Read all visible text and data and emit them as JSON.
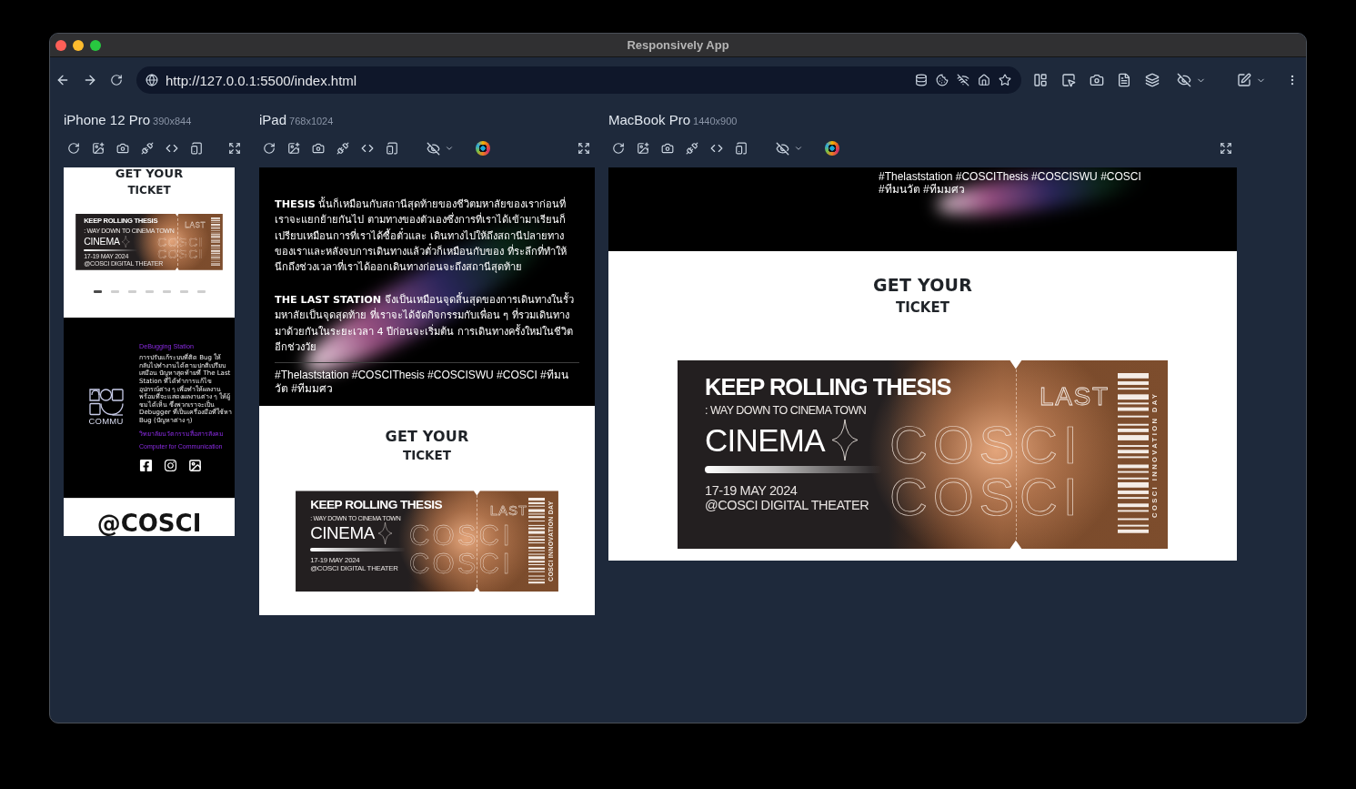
{
  "window": {
    "title": "Responsively App"
  },
  "address_bar": {
    "url": "http://127.0.0.1:5500/index.html"
  },
  "previews": [
    {
      "kind": "phone",
      "name": "iPhone 12 Pro",
      "size": "390x844",
      "sections": [
        {
          "kind": "ticket",
          "heading": "GET YOUR",
          "subheading": "TICKET",
          "ticket": {
            "title": "KEEP ROLLING THESIS",
            "tagline": ": WAY DOWN TO CINEMA TOWN",
            "word": "CINEMA",
            "outline_words": [
              "COSCI",
              "COSCI"
            ],
            "dates": "17-19 MAY 2024",
            "venue": "@COSCI DIGITAL THEATER",
            "logo": "LAST"
          },
          "carousel": [
            {
              "selected": true
            },
            {
              "selected": false
            },
            {
              "selected": false
            },
            {
              "selected": false
            },
            {
              "selected": false
            },
            {
              "selected": false
            },
            {
              "selected": false
            }
          ]
        },
        {
          "kind": "footer",
          "logo_text": "COMMU",
          "title": "DeBugging Station",
          "body": "การปรับแก้ระบบที่ติด Bug ให้กลับไปทำงานได้ตามปกติเปรียบเสมือน ปัญหาสุดท้ายที่ The Last Station ที่ได้ทำการแก้ไขอุปกรณ์ต่าง ๆ เพื่อทำให้ผลงานพร้อมที่จะแสดงผลงานต่าง ๆ ให้ผู้ชมได้เห็น ซึ่งพวกเราจะเป็น Debugger ที่เป็นเครื่องมือที่ใช้หา Bug (ปัญหาต่าง ๆ)",
          "links": [
            "วิทยาลัยนวัตกรรมสื่อสารสังคม",
            "Computer for Communication"
          ]
        },
        {
          "kind": "handle",
          "text": "@COSCI"
        }
      ]
    },
    {
      "kind": "tablet",
      "name": "iPad",
      "size": "768x1024",
      "sections": [
        {
          "kind": "story",
          "paragraphs": [
            "**THESIS** นั้นก็เหมือนกับสถานีสุดท้ายของชีวิตมหาลัยของเราก่อนที่เราจะแยกย้ายกันไป ตามทางของตัวเองซึ่งการที่เราได้เข้ามาเรียนก็เปรียบเหมือนการที่เราได้ซื้อตั๋วและ เดินทางไปให้ถึงสถานีปลายทางของเราและหลังจบการเดินทางแล้วตั๋วก็เหมือนกับของ ที่ระลึกที่ทำให้นึกถึงช่วงเวลาที่เราได้ออกเดินทางก่อนจะถึงสถานีสุดท้าย",
            "**THE LAST STATION** จึงเป็นเหมือนจุดสิ้นสุดของการเดินทางในรั้วมหาลัยเป็นจุดสุดท้าย ที่เราจะได้จัดกิจกรรมกับเพื่อน ๆ ที่รวมเดินทางมาด้วยกันในระยะเวลา 4 ปีก่อนจะเริ่มต้น การเดินทางครั้งใหม่ในชีวิตอีกช่วงวัย"
          ],
          "hashtags": "#Thelaststation #COSCIThesis #COSCISWU #COSCI #ทีมนวัต #ทีมมศว"
        },
        {
          "kind": "ticket",
          "heading": "GET YOUR",
          "subheading": "TICKET",
          "ticket": {
            "title": "KEEP ROLLING THESIS",
            "tagline": ": WAY DOWN TO CINEMA TOWN",
            "word": "CINEMA",
            "outline_words": [
              "COSCI",
              "COSCI"
            ],
            "dates": "17-19 MAY 2024",
            "venue": "@COSCI DIGITAL THEATER",
            "logo": "LAST",
            "side_text": "COSCI INNOVATION DAY"
          }
        }
      ]
    },
    {
      "kind": "desktop",
      "name": "MacBook Pro",
      "size": "1440x900",
      "sections": [
        {
          "kind": "hashtags",
          "text": "#Thelaststation #COSCIThesis #COSCISWU #COSCI #ทีมนวัต #ทีมมศว"
        },
        {
          "kind": "ticket",
          "heading": "GET YOUR",
          "subheading": "TICKET",
          "ticket": {
            "title": "KEEP ROLLING THESIS",
            "tagline": ": WAY DOWN TO CINEMA TOWN",
            "word": "CINEMA",
            "outline_words": [
              "COSCI",
              "COSCI"
            ],
            "dates": "17-19 MAY 2024",
            "venue": "@COSCI DIGITAL THEATER",
            "logo": "LAST",
            "side_text": "COSCI INNOVATION DAY"
          }
        }
      ]
    }
  ]
}
